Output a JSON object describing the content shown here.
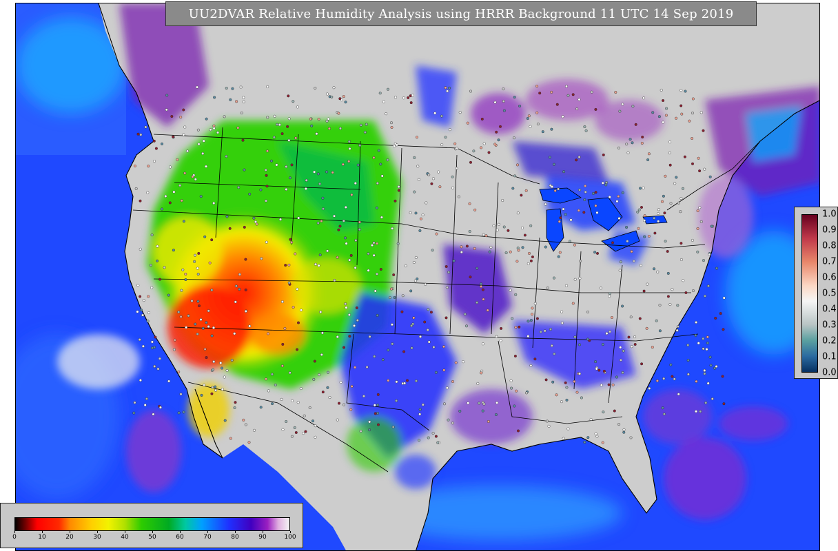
{
  "title": "UU2DVAR Relative Humidity Analysis using HRRR Background 11 UTC 14 Sep 2019",
  "map": {
    "variable": "relative humidity",
    "colors": {
      "ocean": "#2a55ff",
      "land_humid": "#cfcfcf",
      "dry": "#ff2200",
      "mid": "#22cc00",
      "purple": "#7a1fb0",
      "borders": "#000000"
    }
  },
  "rh_colorbar": {
    "min": 0,
    "max": 100,
    "ticks": [
      "0",
      "10",
      "20",
      "30",
      "40",
      "50",
      "60",
      "70",
      "80",
      "90",
      "100"
    ],
    "stops": [
      {
        "v": 0,
        "c": "#000000"
      },
      {
        "v": 4,
        "c": "#7a0000"
      },
      {
        "v": 8,
        "c": "#ff0000"
      },
      {
        "v": 16,
        "c": "#ff2a00"
      },
      {
        "v": 20,
        "c": "#ff8a00"
      },
      {
        "v": 28,
        "c": "#ffd000"
      },
      {
        "v": 34,
        "c": "#f2f200"
      },
      {
        "v": 40,
        "c": "#b0e000"
      },
      {
        "v": 46,
        "c": "#2ecc00"
      },
      {
        "v": 56,
        "c": "#00aa22"
      },
      {
        "v": 62,
        "c": "#00c8a0"
      },
      {
        "v": 68,
        "c": "#00a0ff"
      },
      {
        "v": 78,
        "c": "#1f30ff"
      },
      {
        "v": 86,
        "c": "#4000c0"
      },
      {
        "v": 92,
        "c": "#9a1fc0"
      },
      {
        "v": 96,
        "c": "#e0b0e0"
      },
      {
        "v": 100,
        "c": "#f4f4f4"
      }
    ]
  },
  "ob_colorbar": {
    "ticks": [
      "1.0",
      "0.9",
      "0.8",
      "0.7",
      "0.6",
      "0.5",
      "0.4",
      "0.3",
      "0.2",
      "0.1",
      "0.0"
    ],
    "stops": [
      {
        "v": 1.0,
        "c": "#67001f"
      },
      {
        "v": 0.85,
        "c": "#c0394a"
      },
      {
        "v": 0.7,
        "c": "#e8876a"
      },
      {
        "v": 0.55,
        "c": "#fbd7c4"
      },
      {
        "v": 0.45,
        "c": "#f5f5f5"
      },
      {
        "v": 0.3,
        "c": "#b8c4c4"
      },
      {
        "v": 0.2,
        "c": "#5aa0a0"
      },
      {
        "v": 0.1,
        "c": "#2a6aa0"
      },
      {
        "v": 0.0,
        "c": "#053061"
      }
    ]
  }
}
